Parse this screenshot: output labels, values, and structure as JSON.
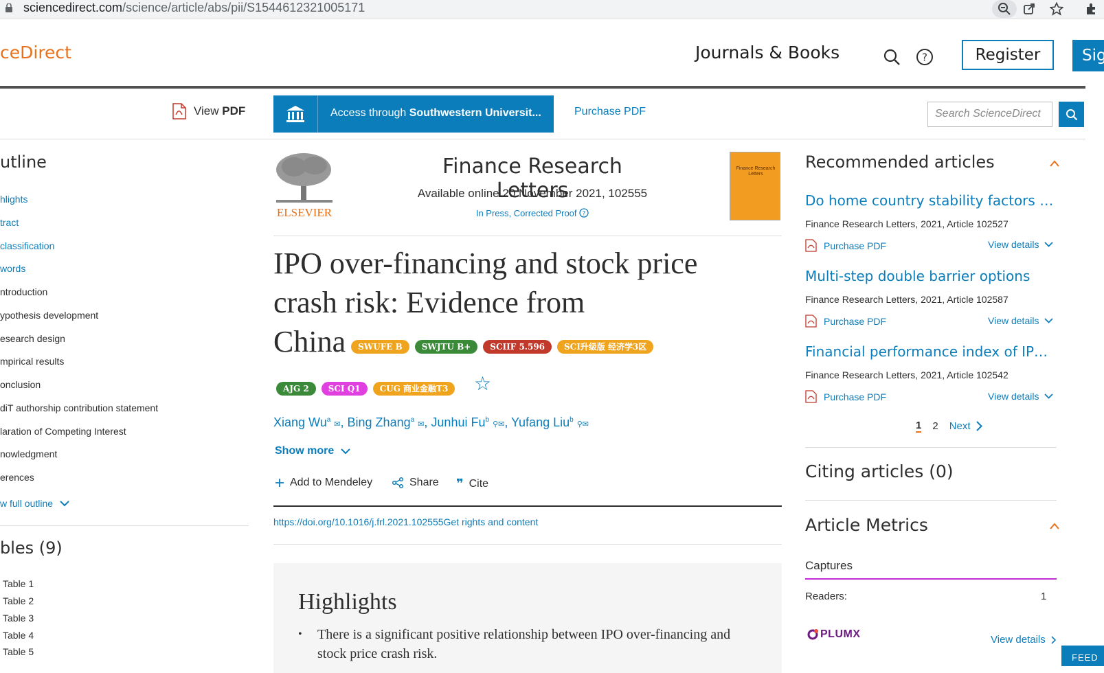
{
  "browser": {
    "url_host": "sciencedirect.com",
    "url_path": "/science/article/abs/pii/S1544612321005171"
  },
  "header": {
    "brand": "ceDirect",
    "journals_books": "Journals & Books",
    "register": "Register",
    "signin": "Sig"
  },
  "toolbar": {
    "view_pdf_pre": "View ",
    "view_pdf_bold": "PDF",
    "access_pre": "Access through ",
    "access_bold": "Southwestern Universit...",
    "purchase_pdf": "Purchase PDF",
    "search_placeholder": "Search ScienceDirect"
  },
  "outline": {
    "title": "utline",
    "items": [
      {
        "label": "hlights",
        "link": true
      },
      {
        "label": "tract",
        "link": true
      },
      {
        "label": "classification",
        "link": true
      },
      {
        "label": "words",
        "link": true
      },
      {
        "label": "ntroduction",
        "link": false
      },
      {
        "label": "ypothesis development",
        "link": false
      },
      {
        "label": "esearch design",
        "link": false
      },
      {
        "label": "mpirical results",
        "link": false
      },
      {
        "label": "onclusion",
        "link": false
      },
      {
        "label": "diT authorship contribution statement",
        "link": false
      },
      {
        "label": "laration of Competing Interest",
        "link": false
      },
      {
        "label": "nowledgment",
        "link": false
      },
      {
        "label": "erences",
        "link": false
      }
    ],
    "show_full": "w full outline",
    "tables_title": "bles (9)",
    "tables": [
      "Table 1",
      "Table 2",
      "Table 3",
      "Table 4",
      "Table 5"
    ]
  },
  "journal": {
    "publisher": "ELSEVIER",
    "title": "Finance Research Letters",
    "available": "Available online 20 November 2021, 102555",
    "status": "In Press, Corrected Proof",
    "cover_title": "Finance Research Letters"
  },
  "article": {
    "title_line1": "IPO over-financing and stock price",
    "title_line2": "crash risk: Evidence from",
    "title_line3": "China",
    "badges": [
      {
        "label": "SWUFE B",
        "color": "#f0a31c"
      },
      {
        "label": "SWJTU B+",
        "color": "#3a8a3a"
      },
      {
        "label": "SCIIF 5.596",
        "color": "#c0392b"
      },
      {
        "label": "SCI升级版 经济学3区",
        "color": "#f0a31c"
      },
      {
        "label": "AJG 2",
        "color": "#3a8a3a"
      },
      {
        "label": "SCI Q1",
        "color": "#e040e0"
      },
      {
        "label": "CUG 商业金融T3",
        "color": "#f0a31c"
      }
    ],
    "authors": [
      {
        "name": "Xiang Wu",
        "sup": "a"
      },
      {
        "name": "Bing Zhang",
        "sup": "a"
      },
      {
        "name": "Junhui Fu",
        "sup": "b"
      },
      {
        "name": "Yufang Liu",
        "sup": "b"
      }
    ],
    "show_more": "Show more",
    "add_mendeley": "Add to Mendeley",
    "share": "Share",
    "cite": "Cite",
    "doi": "https://doi.org/10.1016/j.frl.2021.102555",
    "rights": "Get rights and content",
    "highlights_title": "Highlights",
    "highlight_1": "There is a significant positive relationship between IPO over-financing and stock price crash risk."
  },
  "sidebar": {
    "recommended_title": "Recommended articles",
    "recommended": [
      {
        "title": "Do home country stability factors mat...",
        "source": "Finance Research Letters, 2021, Article 102527"
      },
      {
        "title": "Multi-step double barrier options",
        "source": "Finance Research Letters, 2021, Article 102587"
      },
      {
        "title": "Financial performance index of IPO fi...",
        "source": "Finance Research Letters, 2021, Article 102542"
      }
    ],
    "purchase_pdf": "Purchase PDF",
    "view_details": "View details",
    "page1": "1",
    "page2": "2",
    "next": "Next",
    "citing_title": "Citing articles (0)",
    "metrics_title": "Article Metrics",
    "captures": "Captures",
    "readers_label": "Readers:",
    "readers_value": "1",
    "plumx": "PLUMX",
    "plumx_view": "View details",
    "feedback": "FEED"
  },
  "colors": {
    "accent_blue": "#0c7dbb",
    "brand_orange": "#e9711c"
  }
}
